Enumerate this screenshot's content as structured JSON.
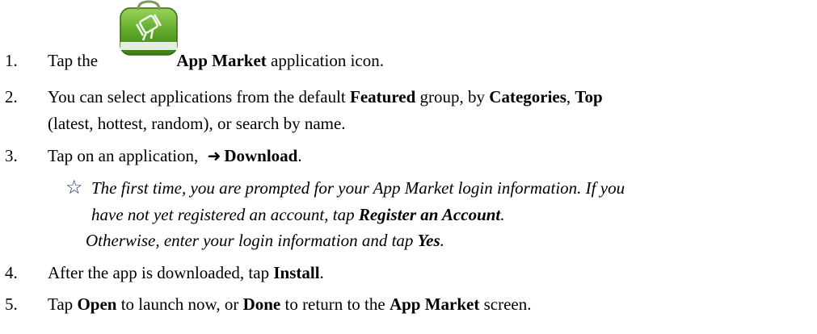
{
  "steps": [
    {
      "num": "1.",
      "pre": "Tap the ",
      "bold1": "App Market",
      "post1": " application icon."
    },
    {
      "num": "2.",
      "pre": "You can select applications from the default ",
      "bold1": "Featured",
      "mid1": " group, by ",
      "bold2": "Categories",
      "mid2": ", ",
      "bold3": "Top",
      "line2": "(latest, hottest, random), or search by name."
    },
    {
      "num": "3.",
      "pre": "Tap on an application, ",
      "bold1": "Download",
      "post1": "."
    },
    {
      "num": "4.",
      "pre": "After the app is downloaded, tap ",
      "bold1": "Install",
      "post1": "."
    },
    {
      "num": "5.",
      "pre": "Tap ",
      "bold1": "Open",
      "mid1": " to launch now, or ",
      "bold2": "Done",
      "mid2": " to return to the ",
      "bold3": "App Market",
      "post1": " screen."
    }
  ],
  "note": {
    "line1": "The first time, you are prompted for your App Market login information. If you",
    "line2_pre": "have not yet registered an account, tap ",
    "line2_bold": "Register an Account",
    "line2_post": ".",
    "line3_pre": "Otherwise, enter your login information and tap ",
    "line3_bold": "Yes",
    "line3_post": "."
  },
  "icons": {
    "app_market": "app-market-icon",
    "arrow": "right-arrow-icon",
    "star": "star-outline-icon"
  },
  "colors": {
    "text": "#000000",
    "star": "#1c2a8a",
    "icon_green": "#5fa82a"
  }
}
